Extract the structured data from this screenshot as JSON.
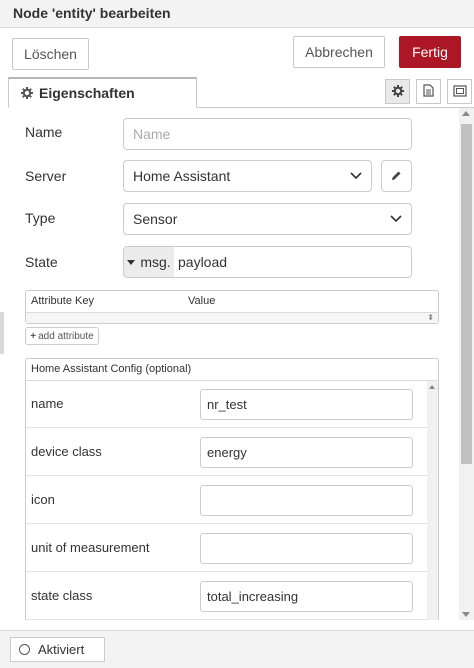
{
  "dialog": {
    "title": "Node 'entity' bearbeiten"
  },
  "buttons": {
    "delete": "Löschen",
    "cancel": "Abbrechen",
    "done": "Fertig"
  },
  "tabs": {
    "properties": "Eigenschaften"
  },
  "form": {
    "name": {
      "label": "Name",
      "placeholder": "Name",
      "value": ""
    },
    "server": {
      "label": "Server",
      "value": "Home Assistant"
    },
    "type": {
      "label": "Type",
      "value": "Sensor"
    },
    "state": {
      "label": "State",
      "type": "msg.",
      "value": "payload"
    }
  },
  "attributes": {
    "col_key": "Attribute Key",
    "col_value": "Value",
    "add_label": "add attribute"
  },
  "config": {
    "title": "Home Assistant Config (optional)",
    "rows": [
      {
        "label": "name",
        "value": "nr_test"
      },
      {
        "label": "device class",
        "value": "energy"
      },
      {
        "label": "icon",
        "value": ""
      },
      {
        "label": "unit of measurement",
        "value": ""
      },
      {
        "label": "state class",
        "value": "total_increasing"
      }
    ]
  },
  "footer": {
    "enabled_label": "Aktiviert"
  },
  "colors": {
    "primary": "#ad1625"
  }
}
